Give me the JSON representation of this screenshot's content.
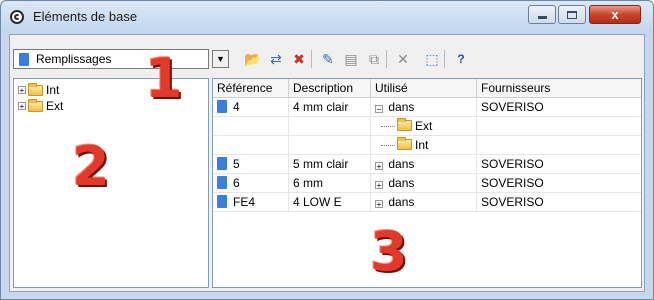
{
  "window": {
    "title": "Eléments de base",
    "close_glyph": "x"
  },
  "combo": {
    "value": "Remplissages",
    "arrow": "▼"
  },
  "toolbar": {
    "buttons": [
      {
        "name": "open-folder-icon",
        "glyph": "📂",
        "color": "#d9a520"
      },
      {
        "name": "rename-icon",
        "glyph": "⇄",
        "color": "#3a6fb0"
      },
      {
        "name": "delete-red-icon",
        "glyph": "✖",
        "color": "#d03020"
      },
      {
        "name": "new-icon",
        "glyph": "✎",
        "color": "#3a6fb0"
      },
      {
        "name": "properties-icon",
        "glyph": "▤",
        "color": "#8a8a8a"
      },
      {
        "name": "copy-icon",
        "glyph": "⧉",
        "color": "#8a8a8a"
      },
      {
        "name": "close-x-icon",
        "glyph": "✕",
        "color": "#8a8a8a"
      },
      {
        "name": "export-icon",
        "glyph": "⬚",
        "color": "#3a6fb0"
      },
      {
        "name": "help-icon",
        "glyph": "?",
        "color": "#2050c0"
      }
    ]
  },
  "tree": {
    "items": [
      {
        "label": "Int",
        "expander": "+"
      },
      {
        "label": "Ext",
        "expander": "+"
      }
    ]
  },
  "grid": {
    "headers": [
      "Référence",
      "Description",
      "Utilisé",
      "Fournisseurs"
    ],
    "rows": [
      {
        "ref": "4",
        "desc": "4 mm clair",
        "used_toggle": "−",
        "used": "dans",
        "supplier": "SOVERISO"
      },
      {
        "ref": "",
        "desc": "",
        "used_child": "Ext",
        "supplier": ""
      },
      {
        "ref": "",
        "desc": "",
        "used_child": "Int",
        "supplier": ""
      },
      {
        "ref": "5",
        "desc": "5 mm clair",
        "used_toggle": "+",
        "used": "dans",
        "supplier": "SOVERISO"
      },
      {
        "ref": "6",
        "desc": "6 mm",
        "used_toggle": "+",
        "used": "dans",
        "supplier": "SOVERISO"
      },
      {
        "ref": "FE4",
        "desc": "4 LOW E",
        "used_toggle": "+",
        "used": "dans",
        "supplier": "SOVERISO"
      }
    ]
  },
  "annotations": {
    "one": "1",
    "two": "2",
    "three": "3",
    "color": "#e23a2a"
  }
}
